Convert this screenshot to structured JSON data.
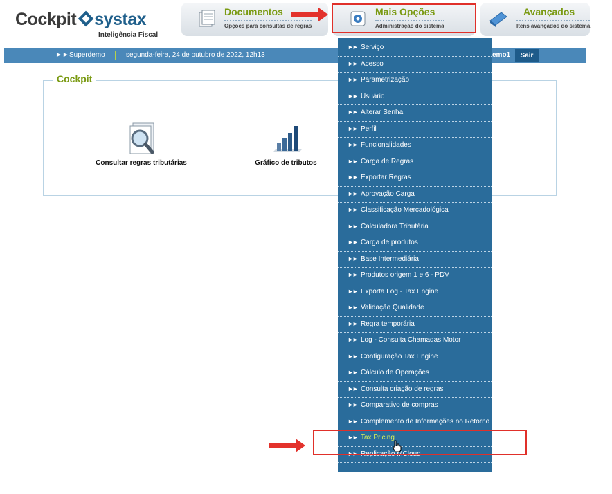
{
  "logo": {
    "word1": "Cockpit",
    "word2": "systax",
    "tagline": "Inteligência Fiscal"
  },
  "nav": {
    "tabs": [
      {
        "title": "Documentos",
        "subtitle": "Opções para consultas de regras",
        "icon": "documents-icon"
      },
      {
        "title": "Mais Opções",
        "subtitle": "Administração do sistema",
        "icon": "gear-icon"
      },
      {
        "title": "Avançados",
        "subtitle": "Itens avançados do sistema",
        "icon": "diamond-icon"
      }
    ]
  },
  "statusbar": {
    "user": "Superdemo",
    "date": "segunda-feira, 24 de outubro de 2022, 12h13",
    "user_right": "emo1",
    "logout_label": "Sair"
  },
  "panel": {
    "title": "Cockpit",
    "items": [
      {
        "label": "Consultar regras tributárias",
        "icon": "magnifier-document-icon"
      },
      {
        "label": "Gráfico de tributos",
        "icon": "bar-chart-icon"
      }
    ]
  },
  "menu": {
    "items": [
      "Serviço",
      "Acesso",
      "Parametrização",
      "Usuário",
      "Alterar Senha",
      "Perfil",
      "Funcionalidades",
      "Carga de Regras",
      "Exportar Regras",
      "Aprovação Carga",
      "Classificação Mercadológica",
      "Calculadora Tributária",
      "Carga de produtos",
      "Base Intermediária",
      "Produtos origem 1 e 6 - PDV",
      "Exporta Log - Tax Engine",
      "Validação Qualidade",
      "Regra temporária",
      "Log - Consulta Chamadas Motor",
      "Configuração Tax Engine",
      "Cálculo de Operações",
      "Consulta criação de regras",
      "Comparativo de compras",
      "Complemento de Informações no Retorno",
      "Tax Pricing",
      "Replicação MCloud"
    ],
    "active_item": "Tax Pricing"
  },
  "colors": {
    "accent_green": "#7a9a12",
    "bar_blue": "#4a88b9",
    "menu_blue": "#2a6c9b",
    "highlight_red": "#e0302a"
  }
}
